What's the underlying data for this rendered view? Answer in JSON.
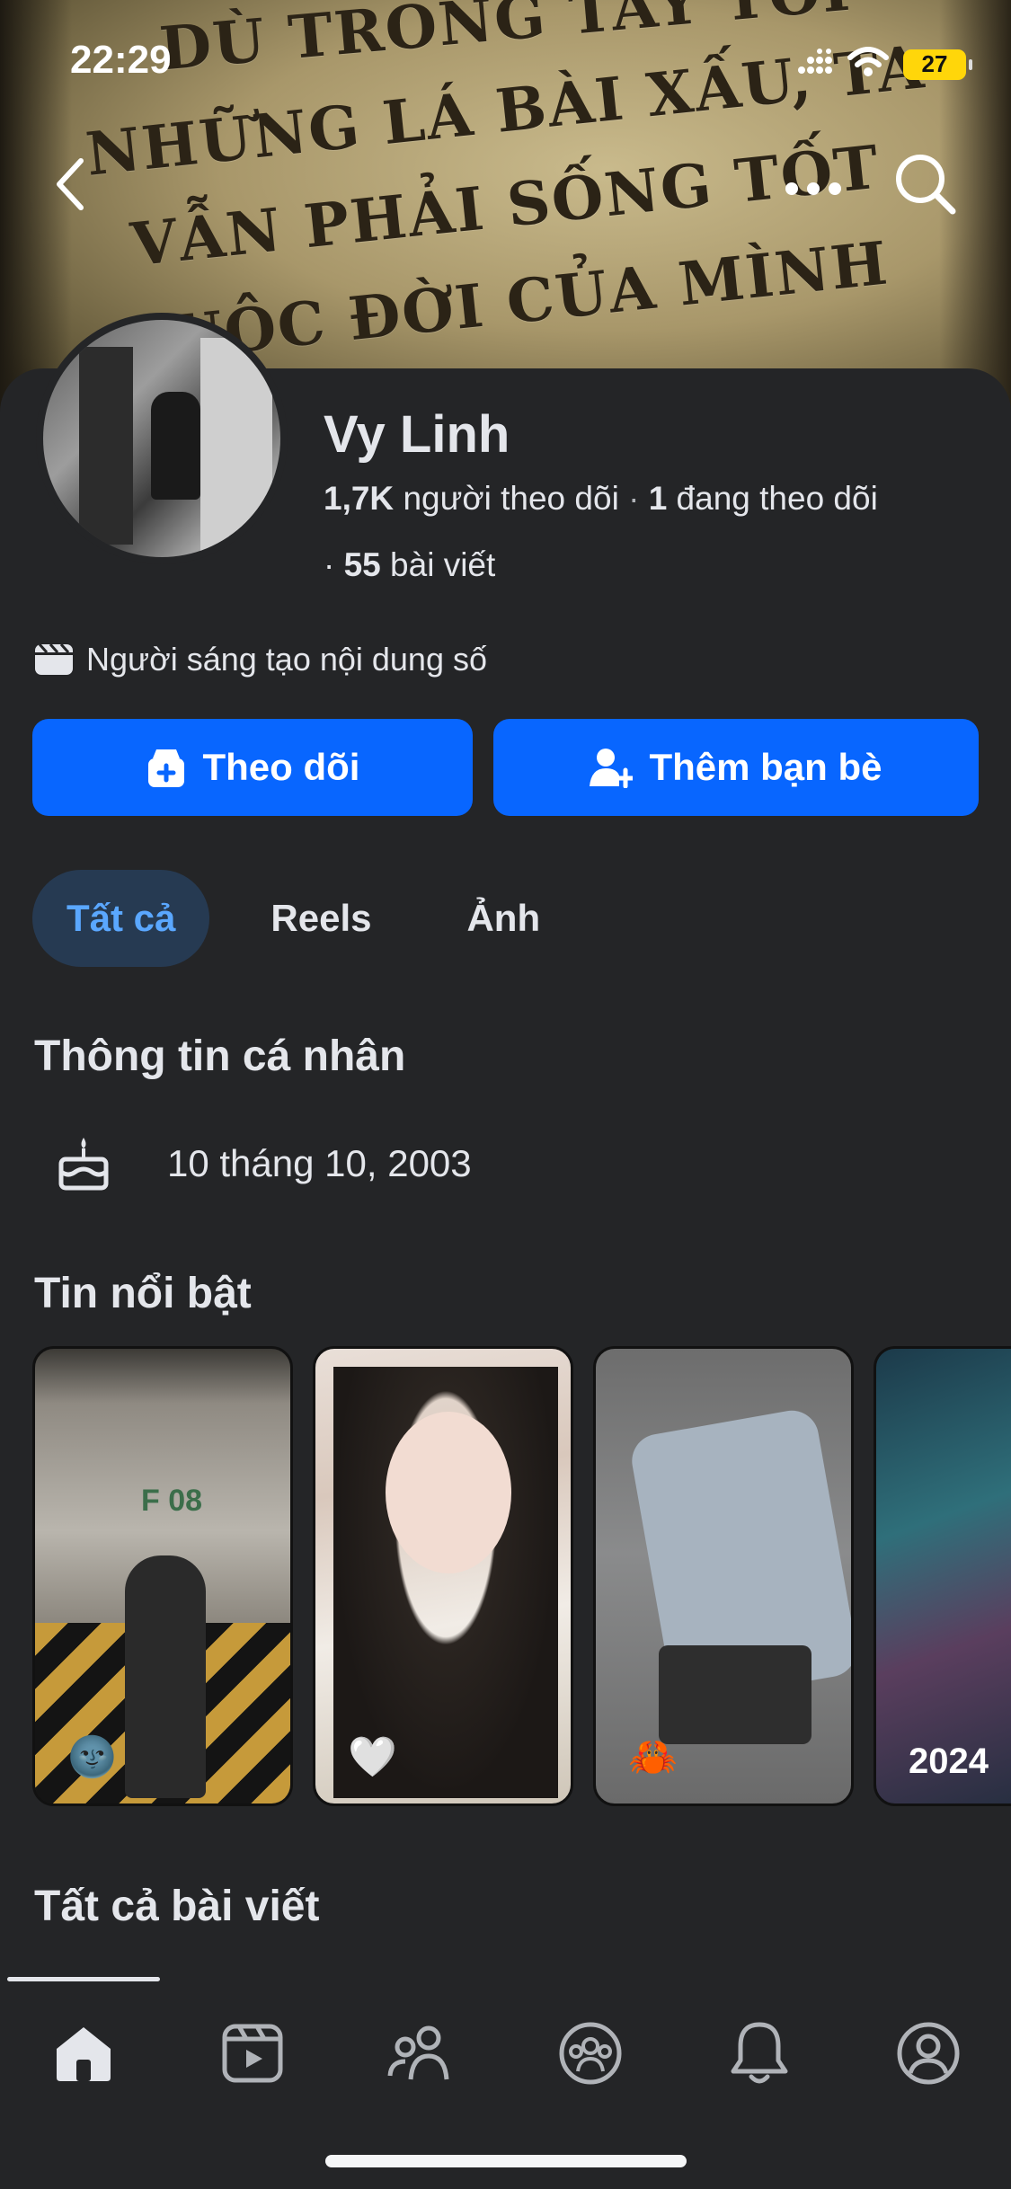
{
  "status_bar": {
    "time": "22:29",
    "battery": "27"
  },
  "cover": {
    "lines": [
      "DÙ TRONG TAY TÔI",
      "NHỮNG LÁ BÀI XẤU, TA",
      "VẪN PHẢI SỐNG TỐT",
      "CUỘC ĐỜI CỦA MÌNH"
    ]
  },
  "profile": {
    "name": "Vy Linh",
    "followers_count": "1,7K",
    "followers_label": "người theo dõi",
    "separator": " · ",
    "following_count": "1",
    "following_label": "đang theo dõi",
    "posts_prefix": "· ",
    "posts_count": "55",
    "posts_label": "bài viết",
    "creator_label": "Người sáng tạo nội dung số"
  },
  "actions": {
    "follow_label": "Theo dõi",
    "add_friend_label": "Thêm bạn bè"
  },
  "tabs": [
    {
      "label": "Tất cả",
      "active": true
    },
    {
      "label": "Reels",
      "active": false
    },
    {
      "label": "Ảnh",
      "active": false
    }
  ],
  "about": {
    "title": "Thông tin cá nhân",
    "birthday": "10 tháng 10, 2003"
  },
  "highlights": {
    "title": "Tin nổi bật",
    "items": [
      {
        "emoji": "🌚",
        "sign": "F 08"
      },
      {
        "emoji": "🤍"
      },
      {
        "emoji": "🦀"
      },
      {
        "year": "2024"
      }
    ]
  },
  "posts": {
    "title": "Tất cả bài viết"
  },
  "bottom_nav": [
    "home-icon",
    "video-icon",
    "friends-icon",
    "groups-icon",
    "notifications-icon",
    "profile-icon"
  ],
  "colors": {
    "accent": "#0866ff",
    "background": "#242527",
    "tab_active_bg": "#263a52",
    "tab_active_text": "#5aa7ff"
  }
}
